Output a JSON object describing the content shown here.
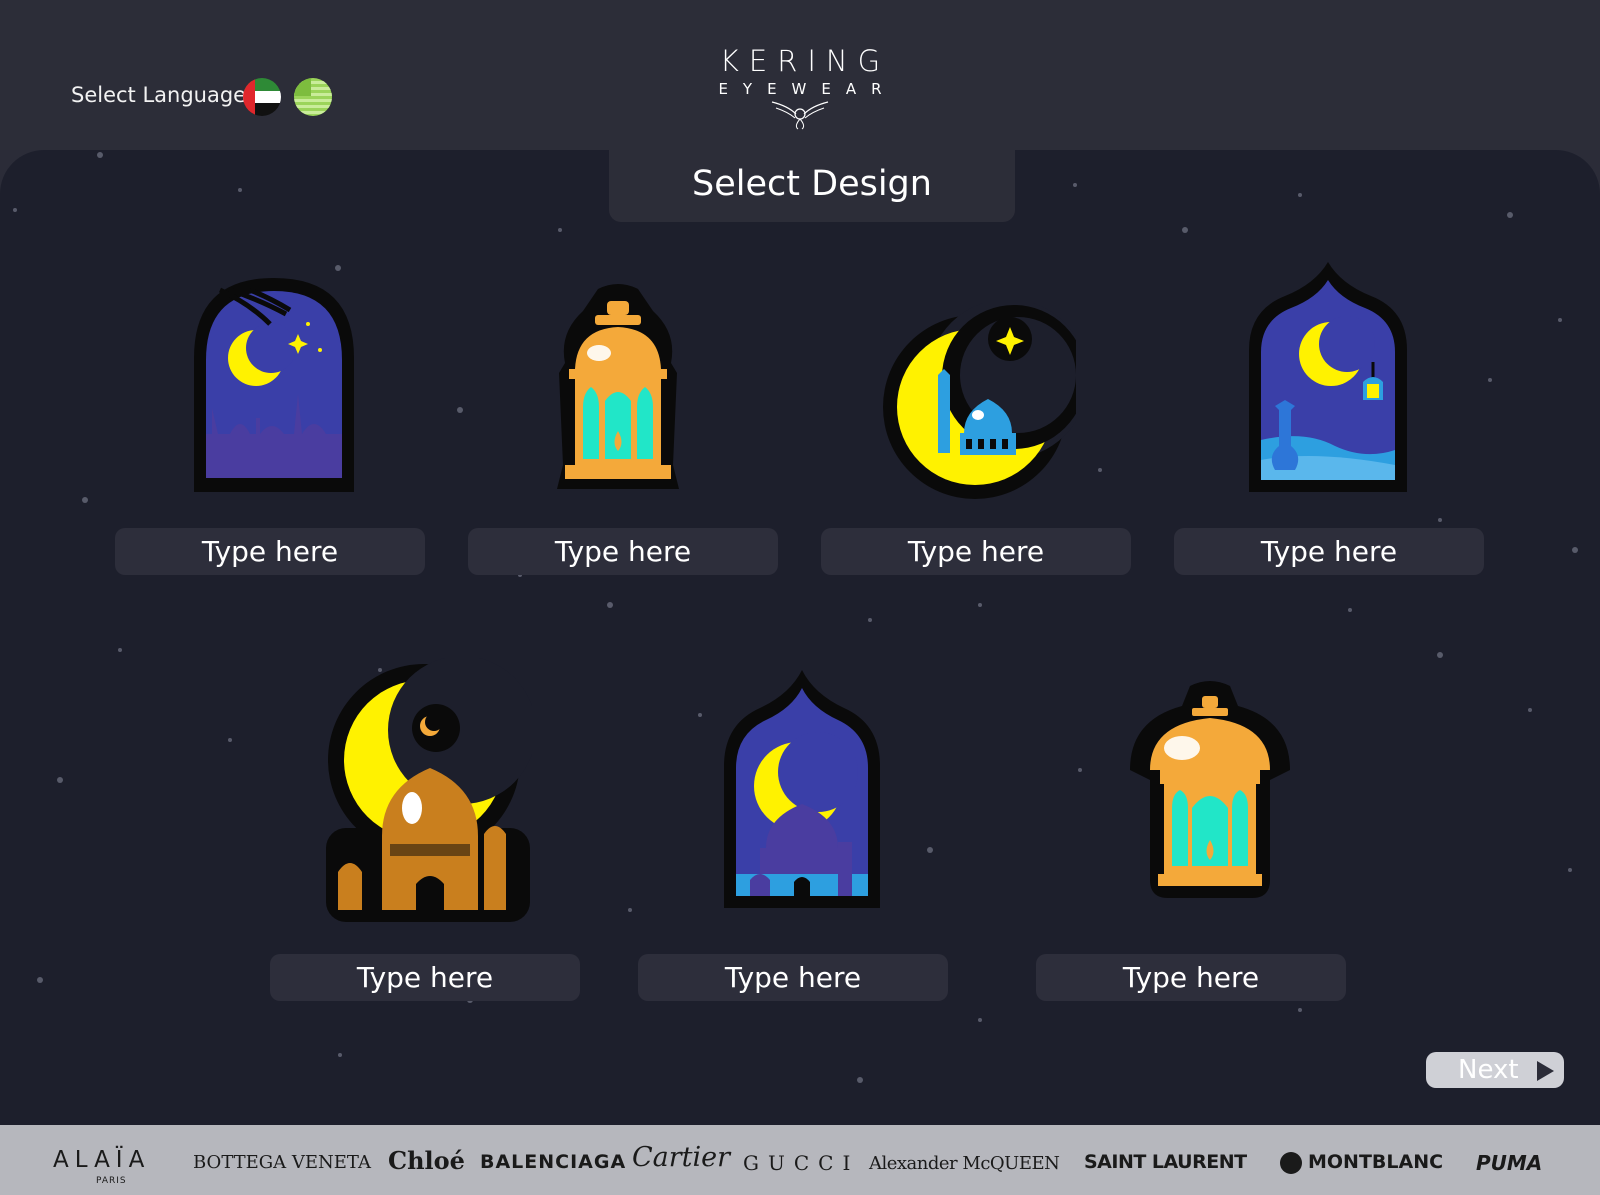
{
  "header": {
    "language_label": "Select Language",
    "languages": [
      {
        "name": "uae-flag",
        "code": "ar"
      },
      {
        "name": "us-flag",
        "code": "en"
      }
    ],
    "logo": {
      "line1": "KERING",
      "line2": "EYEWEAR"
    }
  },
  "main": {
    "title": "Select Design",
    "designs": [
      {
        "icon": "arch-window-moon-city-icon",
        "placeholder": "Type here"
      },
      {
        "icon": "lantern-icon",
        "placeholder": "Type here"
      },
      {
        "icon": "crescent-mosque-icon",
        "placeholder": "Type here"
      },
      {
        "icon": "arch-window-moon-desert-icon",
        "placeholder": "Type here"
      },
      {
        "icon": "crescent-domed-mosque-icon",
        "placeholder": "Type here"
      },
      {
        "icon": "arch-window-moon-mosque-icon",
        "placeholder": "Type here"
      },
      {
        "icon": "dome-lantern-icon",
        "placeholder": "Type here"
      }
    ],
    "next_label": "Next"
  },
  "brands": {
    "alaia": "ALAÏA",
    "alaia_sub": "PARIS",
    "bottega": "BOTTEGA VENETA",
    "chloe": "Chloé",
    "balenciaga": "BALENCIAGA",
    "cartier": "Cartier",
    "gucci": "GUCCI",
    "mcqueen": "Alexander McQUEEN",
    "saint_laurent": "SAINT LAURENT",
    "montblanc": "MONTBLANC",
    "puma": "PUMA"
  },
  "colors": {
    "background": "#1d1f2c",
    "header": "#2c2d38",
    "moon_yellow": "#fff200",
    "night_blue": "#3a3fa8",
    "lantern_orange": "#f4a93a",
    "lantern_glass": "#21e6c8",
    "brand_bar": "#b6b7bd"
  }
}
